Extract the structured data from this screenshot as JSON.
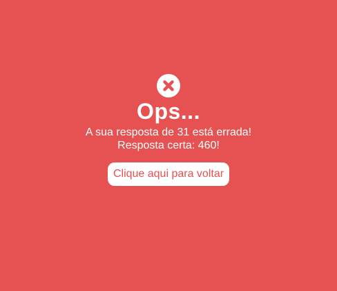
{
  "result": {
    "icon": "close-circle-icon",
    "title": "Ops...",
    "wrong_message": "A sua resposta de 31 está errada!",
    "correct_message": "Resposta certa: 460!",
    "back_button_label": "Clique aqui para voltar"
  },
  "colors": {
    "background": "#e65252",
    "text": "#ffffff",
    "button_background": "#ffffff",
    "button_text": "#e65252"
  }
}
